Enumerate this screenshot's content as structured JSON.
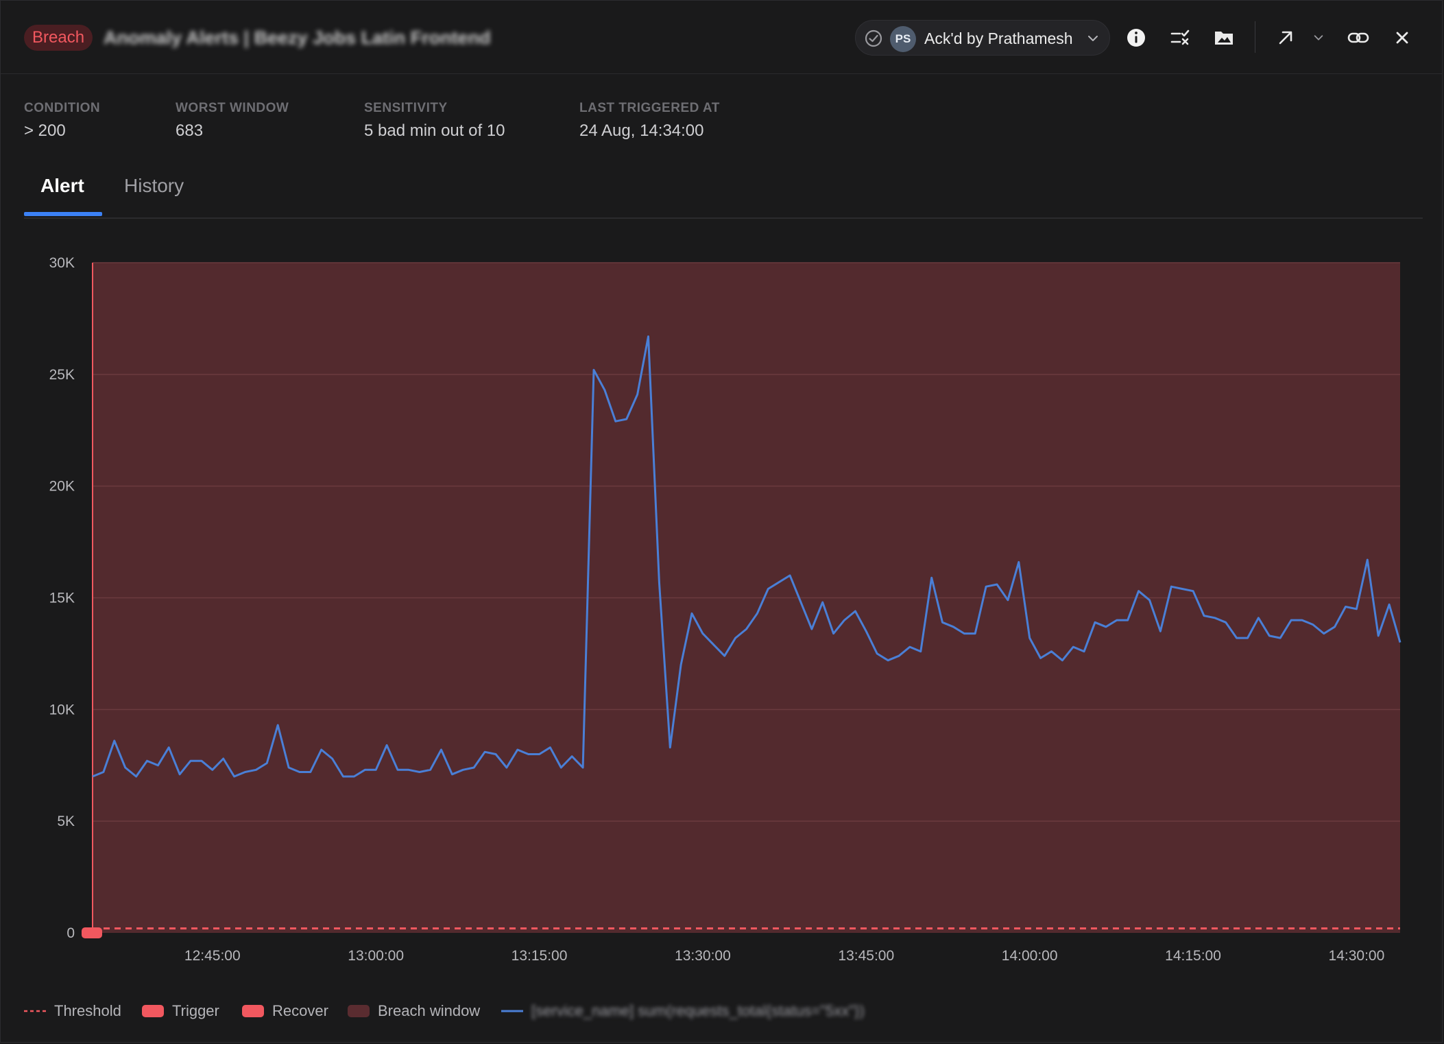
{
  "header": {
    "badge": "Breach",
    "title": "Anomaly Alerts | Beezy Jobs Latin Frontend",
    "ack": {
      "initials": "PS",
      "label": "Ack'd by Prathamesh"
    },
    "icons": [
      "check-circle-icon",
      "info-icon",
      "list-check-icon",
      "folder-image-icon",
      "external-link-icon",
      "chevron-down-icon",
      "link-icon",
      "close-icon"
    ]
  },
  "stats": [
    {
      "label": "CONDITION",
      "value": "> 200"
    },
    {
      "label": "WORST WINDOW",
      "value": "683"
    },
    {
      "label": "SENSITIVITY",
      "value": "5 bad min out of 10"
    },
    {
      "label": "LAST TRIGGERED AT",
      "value": "24 Aug, 14:34:00"
    }
  ],
  "tabs": [
    {
      "label": "Alert",
      "active": true
    },
    {
      "label": "History",
      "active": false
    }
  ],
  "legend": {
    "threshold": "Threshold",
    "trigger": "Trigger",
    "recover": "Recover",
    "breach_window": "Breach window",
    "series": "[service_name] sum(requests_total{status=\"5xx\"})"
  },
  "colors": {
    "accent": "#3c82f6",
    "breach": "#f1585f",
    "breach_window": "#532a2e",
    "series": "#4a7fd6"
  },
  "chart_data": {
    "type": "line",
    "ylim": [
      0,
      30000
    ],
    "yticks": [
      0,
      5000,
      10000,
      15000,
      20000,
      25000,
      30000
    ],
    "ytick_labels": [
      "0",
      "5K",
      "10K",
      "15K",
      "20K",
      "25K",
      "30K"
    ],
    "xlim": [
      "12:34:00",
      "14:34:00"
    ],
    "xticks": [
      "12:45:00",
      "13:00:00",
      "13:15:00",
      "13:30:00",
      "13:45:00",
      "14:00:00",
      "14:15:00",
      "14:30:00"
    ],
    "threshold": 200,
    "breach_window": [
      "12:34:00",
      "14:34:00"
    ],
    "trigger_at": "12:34:00",
    "grid": true,
    "legend_position": "bottom-left",
    "series": [
      {
        "name": "[service_name] sum(requests_total{status=\"5xx\"})",
        "x": [
          "12:34:00",
          "12:35:00",
          "12:36:00",
          "12:37:00",
          "12:38:00",
          "12:39:00",
          "12:40:00",
          "12:41:00",
          "12:42:00",
          "12:43:00",
          "12:44:00",
          "12:45:00",
          "12:46:00",
          "12:47:00",
          "12:48:00",
          "12:49:00",
          "12:50:00",
          "12:51:00",
          "12:52:00",
          "12:53:00",
          "12:54:00",
          "12:55:00",
          "12:56:00",
          "12:57:00",
          "12:58:00",
          "12:59:00",
          "13:00:00",
          "13:01:00",
          "13:02:00",
          "13:03:00",
          "13:04:00",
          "13:05:00",
          "13:06:00",
          "13:07:00",
          "13:08:00",
          "13:09:00",
          "13:10:00",
          "13:11:00",
          "13:12:00",
          "13:13:00",
          "13:14:00",
          "13:15:00",
          "13:16:00",
          "13:17:00",
          "13:18:00",
          "13:19:00",
          "13:20:00",
          "13:21:00",
          "13:22:00",
          "13:23:00",
          "13:24:00",
          "13:25:00",
          "13:26:00",
          "13:27:00",
          "13:28:00",
          "13:29:00",
          "13:30:00",
          "13:31:00",
          "13:32:00",
          "13:33:00",
          "13:34:00",
          "13:35:00",
          "13:36:00",
          "13:37:00",
          "13:38:00",
          "13:39:00",
          "13:40:00",
          "13:41:00",
          "13:42:00",
          "13:43:00",
          "13:44:00",
          "13:45:00",
          "13:46:00",
          "13:47:00",
          "13:48:00",
          "13:49:00",
          "13:50:00",
          "13:51:00",
          "13:52:00",
          "13:53:00",
          "13:54:00",
          "13:55:00",
          "13:56:00",
          "13:57:00",
          "13:58:00",
          "13:59:00",
          "14:00:00",
          "14:01:00",
          "14:02:00",
          "14:03:00",
          "14:04:00",
          "14:05:00",
          "14:06:00",
          "14:07:00",
          "14:08:00",
          "14:09:00",
          "14:10:00",
          "14:11:00",
          "14:12:00",
          "14:13:00",
          "14:14:00",
          "14:15:00",
          "14:16:00",
          "14:17:00",
          "14:18:00",
          "14:19:00",
          "14:20:00",
          "14:21:00",
          "14:22:00",
          "14:23:00",
          "14:24:00",
          "14:25:00",
          "14:26:00",
          "14:27:00",
          "14:28:00",
          "14:29:00",
          "14:30:00",
          "14:31:00",
          "14:32:00",
          "14:33:00",
          "14:34:00"
        ],
        "values": [
          7000,
          7200,
          8600,
          7400,
          7000,
          7700,
          7500,
          8300,
          7100,
          7700,
          7700,
          7300,
          7800,
          7000,
          7200,
          7300,
          7600,
          9300,
          7400,
          7200,
          7200,
          8200,
          7800,
          7000,
          7000,
          7300,
          7300,
          8400,
          7300,
          7300,
          7200,
          7300,
          8200,
          7100,
          7300,
          7400,
          8100,
          8000,
          7400,
          8200,
          8000,
          8000,
          8300,
          7400,
          7900,
          7400,
          25200,
          24300,
          22900,
          23000,
          24100,
          26700,
          15700,
          8300,
          12000,
          14300,
          13400,
          12900,
          12400,
          13200,
          13600,
          14300,
          15400,
          15700,
          16000,
          14800,
          13600,
          14800,
          13400,
          14000,
          14400,
          13500,
          12500,
          12200,
          12400,
          12800,
          12600,
          15900,
          13900,
          13700,
          13400,
          13400,
          15500,
          15600,
          14900,
          16600,
          13200,
          12300,
          12600,
          12200,
          12800,
          12600,
          13900,
          13700,
          14000,
          14000,
          15300,
          14900,
          13500,
          15500,
          15400,
          15300,
          14200,
          14100,
          13900,
          13200,
          13200,
          14100,
          13300,
          13200,
          14000,
          14000,
          13800,
          13400,
          13700,
          14600,
          14500,
          16700,
          13300,
          14700,
          13000
        ]
      }
    ]
  }
}
